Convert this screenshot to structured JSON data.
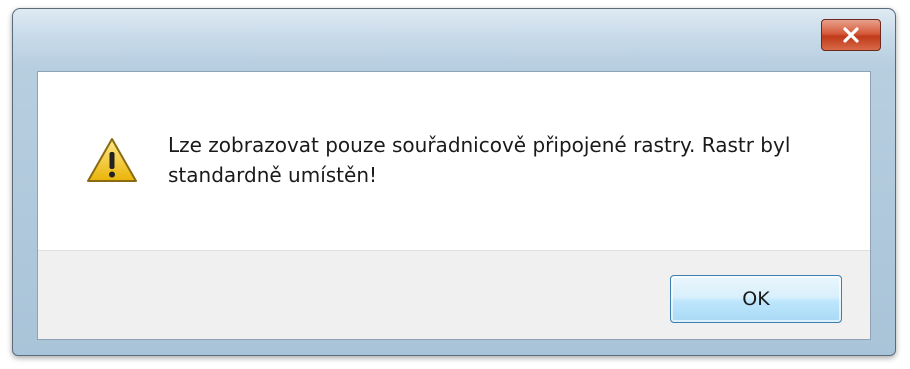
{
  "dialog": {
    "message": "Lze zobrazovat pouze souřadnicově připojené rastry. Rastr byl standardně umístěn!",
    "ok_label": "OK",
    "icon": "warning-icon"
  },
  "colors": {
    "close_button": "#d55b3c",
    "ok_button_border": "#3c7fb1",
    "footer_background": "#f0f0f0",
    "warning_yellow": "#f5c518"
  }
}
